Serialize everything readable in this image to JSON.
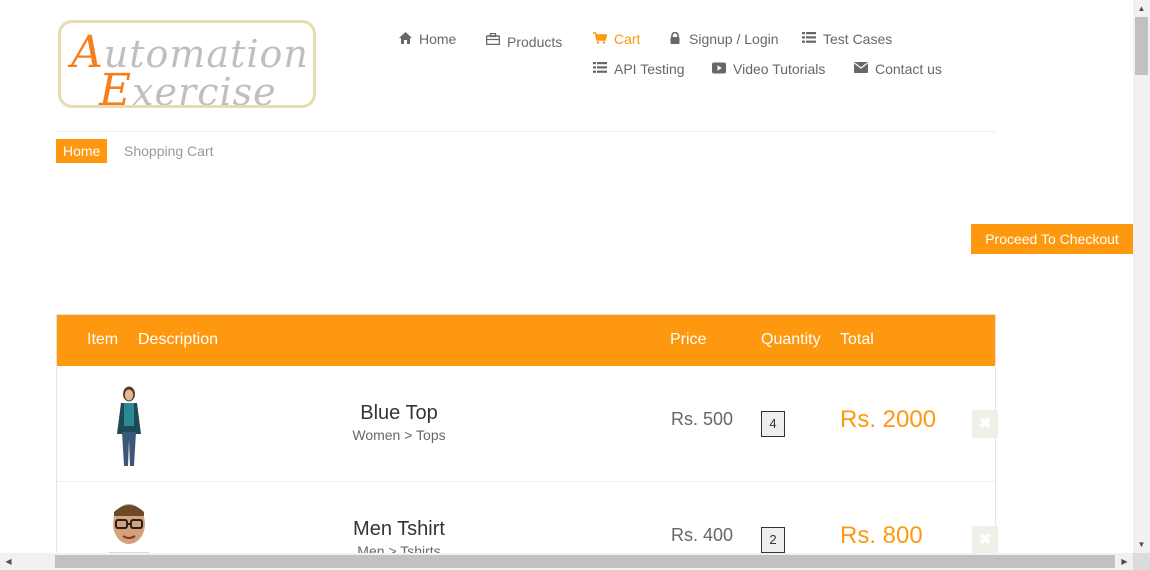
{
  "logo": {
    "line1_cap": "A",
    "line1_rest": "utomation",
    "line2_cap": "E",
    "line2_rest": "xercise"
  },
  "nav": {
    "home": "Home",
    "products": "Products",
    "cart": "Cart",
    "signup": "Signup / Login",
    "test_cases": "Test Cases",
    "api_testing": "API Testing",
    "video_tutorials": "Video Tutorials",
    "contact": "Contact us"
  },
  "breadcrumb": {
    "home": "Home",
    "current": "Shopping Cart"
  },
  "checkout_label": "Proceed To Checkout",
  "table": {
    "headers": {
      "item": "Item",
      "description": "Description",
      "price": "Price",
      "quantity": "Quantity",
      "total": "Total"
    },
    "rows": [
      {
        "name": "Blue Top",
        "category": "Women > Tops",
        "price": "Rs. 500",
        "quantity": "4",
        "total": "Rs. 2000"
      },
      {
        "name": "Men Tshirt",
        "category": "Men > Tshirts",
        "price": "Rs. 400",
        "quantity": "2",
        "total": "Rs. 800"
      }
    ]
  },
  "colors": {
    "accent": "#fe980f",
    "text": "#696763",
    "logo_border": "#e7dbb3"
  },
  "icons": {
    "home": "home-icon",
    "products": "briefcase-icon",
    "cart": "shopping-cart-icon",
    "signup": "lock-icon",
    "test_cases": "list-icon",
    "api_testing": "list-icon",
    "video_tutorials": "youtube-play-icon",
    "contact": "envelope-icon",
    "delete": "close-icon"
  }
}
